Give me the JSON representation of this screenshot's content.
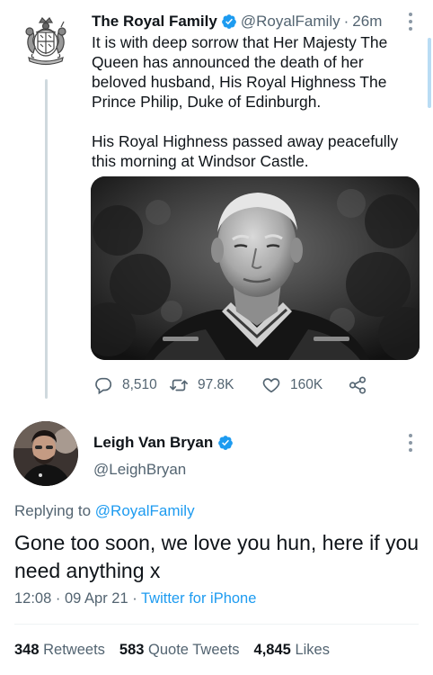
{
  "original_tweet": {
    "author_name": "The Royal Family",
    "handle": "@RoyalFamily",
    "time_ago": "26m",
    "separator": "·",
    "paragraph_1": "It is with deep sorrow that Her Majesty The Queen has announced the death of her beloved husband, His Royal Highness The Prince Philip, Duke of Edinburgh.",
    "paragraph_2": "His Royal Highness passed away peacefully this morning at Windsor Castle.",
    "counts": {
      "replies": "8,510",
      "retweets": "97.8K",
      "likes": "160K"
    }
  },
  "reply_tweet": {
    "author_name": "Leigh Van Bryan",
    "handle": "@LeighBryan",
    "replying_prefix": "Replying to",
    "replying_to": "@RoyalFamily",
    "text": "Gone too soon, we love you hun, here if you need anything x",
    "time": "12:08",
    "separator_1": "·",
    "date": "09 Apr 21",
    "separator_2": "·",
    "client": "Twitter for iPhone",
    "stats": {
      "retweets_count": "348",
      "retweets_label": "Retweets",
      "quotes_count": "583",
      "quotes_label": "Quote Tweets",
      "likes_count": "4,845",
      "likes_label": "Likes"
    }
  },
  "icons": {
    "verified": "verified-badge-icon",
    "reply": "reply-icon",
    "retweet": "retweet-icon",
    "like": "heart-icon",
    "share": "share-icon",
    "more": "more-options-icon"
  },
  "colors": {
    "accent": "#1d9bf0",
    "text_primary": "#0f1419",
    "text_secondary": "#536471",
    "thread_line": "#cfd9de"
  }
}
